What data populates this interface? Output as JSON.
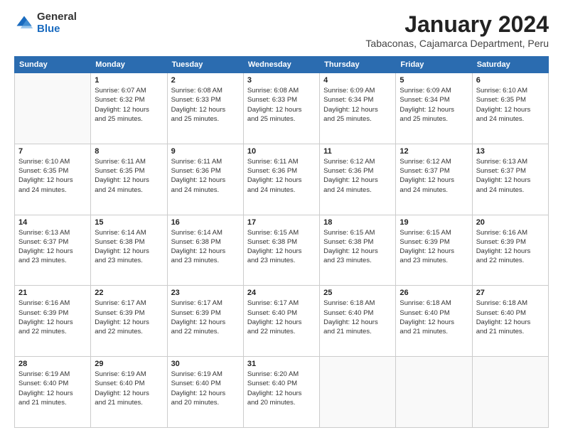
{
  "header": {
    "logo": {
      "general": "General",
      "blue": "Blue"
    },
    "title": "January 2024",
    "subtitle": "Tabaconas, Cajamarca Department, Peru"
  },
  "calendar": {
    "days_of_week": [
      "Sunday",
      "Monday",
      "Tuesday",
      "Wednesday",
      "Thursday",
      "Friday",
      "Saturday"
    ],
    "weeks": [
      [
        {
          "day": "",
          "info": ""
        },
        {
          "day": "1",
          "info": "Sunrise: 6:07 AM\nSunset: 6:32 PM\nDaylight: 12 hours\nand 25 minutes."
        },
        {
          "day": "2",
          "info": "Sunrise: 6:08 AM\nSunset: 6:33 PM\nDaylight: 12 hours\nand 25 minutes."
        },
        {
          "day": "3",
          "info": "Sunrise: 6:08 AM\nSunset: 6:33 PM\nDaylight: 12 hours\nand 25 minutes."
        },
        {
          "day": "4",
          "info": "Sunrise: 6:09 AM\nSunset: 6:34 PM\nDaylight: 12 hours\nand 25 minutes."
        },
        {
          "day": "5",
          "info": "Sunrise: 6:09 AM\nSunset: 6:34 PM\nDaylight: 12 hours\nand 25 minutes."
        },
        {
          "day": "6",
          "info": "Sunrise: 6:10 AM\nSunset: 6:35 PM\nDaylight: 12 hours\nand 24 minutes."
        }
      ],
      [
        {
          "day": "7",
          "info": "Sunrise: 6:10 AM\nSunset: 6:35 PM\nDaylight: 12 hours\nand 24 minutes."
        },
        {
          "day": "8",
          "info": "Sunrise: 6:11 AM\nSunset: 6:35 PM\nDaylight: 12 hours\nand 24 minutes."
        },
        {
          "day": "9",
          "info": "Sunrise: 6:11 AM\nSunset: 6:36 PM\nDaylight: 12 hours\nand 24 minutes."
        },
        {
          "day": "10",
          "info": "Sunrise: 6:11 AM\nSunset: 6:36 PM\nDaylight: 12 hours\nand 24 minutes."
        },
        {
          "day": "11",
          "info": "Sunrise: 6:12 AM\nSunset: 6:36 PM\nDaylight: 12 hours\nand 24 minutes."
        },
        {
          "day": "12",
          "info": "Sunrise: 6:12 AM\nSunset: 6:37 PM\nDaylight: 12 hours\nand 24 minutes."
        },
        {
          "day": "13",
          "info": "Sunrise: 6:13 AM\nSunset: 6:37 PM\nDaylight: 12 hours\nand 24 minutes."
        }
      ],
      [
        {
          "day": "14",
          "info": "Sunrise: 6:13 AM\nSunset: 6:37 PM\nDaylight: 12 hours\nand 23 minutes."
        },
        {
          "day": "15",
          "info": "Sunrise: 6:14 AM\nSunset: 6:38 PM\nDaylight: 12 hours\nand 23 minutes."
        },
        {
          "day": "16",
          "info": "Sunrise: 6:14 AM\nSunset: 6:38 PM\nDaylight: 12 hours\nand 23 minutes."
        },
        {
          "day": "17",
          "info": "Sunrise: 6:15 AM\nSunset: 6:38 PM\nDaylight: 12 hours\nand 23 minutes."
        },
        {
          "day": "18",
          "info": "Sunrise: 6:15 AM\nSunset: 6:38 PM\nDaylight: 12 hours\nand 23 minutes."
        },
        {
          "day": "19",
          "info": "Sunrise: 6:15 AM\nSunset: 6:39 PM\nDaylight: 12 hours\nand 23 minutes."
        },
        {
          "day": "20",
          "info": "Sunrise: 6:16 AM\nSunset: 6:39 PM\nDaylight: 12 hours\nand 22 minutes."
        }
      ],
      [
        {
          "day": "21",
          "info": "Sunrise: 6:16 AM\nSunset: 6:39 PM\nDaylight: 12 hours\nand 22 minutes."
        },
        {
          "day": "22",
          "info": "Sunrise: 6:17 AM\nSunset: 6:39 PM\nDaylight: 12 hours\nand 22 minutes."
        },
        {
          "day": "23",
          "info": "Sunrise: 6:17 AM\nSunset: 6:39 PM\nDaylight: 12 hours\nand 22 minutes."
        },
        {
          "day": "24",
          "info": "Sunrise: 6:17 AM\nSunset: 6:40 PM\nDaylight: 12 hours\nand 22 minutes."
        },
        {
          "day": "25",
          "info": "Sunrise: 6:18 AM\nSunset: 6:40 PM\nDaylight: 12 hours\nand 21 minutes."
        },
        {
          "day": "26",
          "info": "Sunrise: 6:18 AM\nSunset: 6:40 PM\nDaylight: 12 hours\nand 21 minutes."
        },
        {
          "day": "27",
          "info": "Sunrise: 6:18 AM\nSunset: 6:40 PM\nDaylight: 12 hours\nand 21 minutes."
        }
      ],
      [
        {
          "day": "28",
          "info": "Sunrise: 6:19 AM\nSunset: 6:40 PM\nDaylight: 12 hours\nand 21 minutes."
        },
        {
          "day": "29",
          "info": "Sunrise: 6:19 AM\nSunset: 6:40 PM\nDaylight: 12 hours\nand 21 minutes."
        },
        {
          "day": "30",
          "info": "Sunrise: 6:19 AM\nSunset: 6:40 PM\nDaylight: 12 hours\nand 20 minutes."
        },
        {
          "day": "31",
          "info": "Sunrise: 6:20 AM\nSunset: 6:40 PM\nDaylight: 12 hours\nand 20 minutes."
        },
        {
          "day": "",
          "info": ""
        },
        {
          "day": "",
          "info": ""
        },
        {
          "day": "",
          "info": ""
        }
      ]
    ]
  }
}
